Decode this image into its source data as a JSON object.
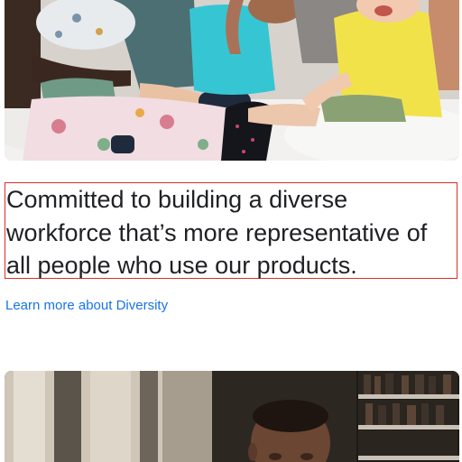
{
  "feature": {
    "headline": "Committed to building a diverse workforce that’s more representative of all people who use our products.",
    "link_label": "Learn more about Diversity"
  },
  "colors": {
    "link": "#1a73e8",
    "headline_text": "#202124",
    "focus_outline": "#d93025"
  }
}
